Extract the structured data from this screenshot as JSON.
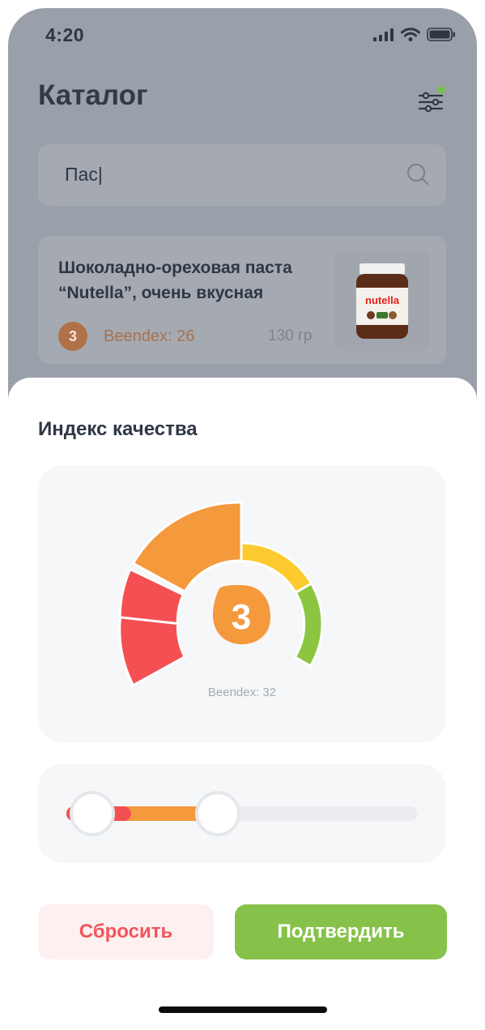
{
  "status": {
    "time": "4:20"
  },
  "header": {
    "title": "Каталог"
  },
  "search": {
    "value": "Пас|"
  },
  "product": {
    "title": "Шоколадно-ореховая паста “Nutella”, очень вкусная",
    "rating": "3",
    "beendex": "Beendex: 26",
    "weight": "130 гр",
    "image_label": "nutella"
  },
  "sheet": {
    "title": "Индекс качества",
    "gauge": {
      "value": "3",
      "caption": "Beendex: 32"
    },
    "range_slider": {
      "low": 0.0,
      "high": 0.43,
      "red_share": 0.13
    },
    "reset_label": "Сбросить",
    "confirm_label": "Подтвердить"
  },
  "colors": {
    "red": "#f44f52",
    "orange": "#f5993d",
    "yellow": "#fdcb2f",
    "green": "#8cc640",
    "accent_dot": "#74c043"
  },
  "icons": [
    "signal-icon",
    "wifi-icon",
    "battery-icon",
    "filter-icon",
    "search-icon"
  ]
}
